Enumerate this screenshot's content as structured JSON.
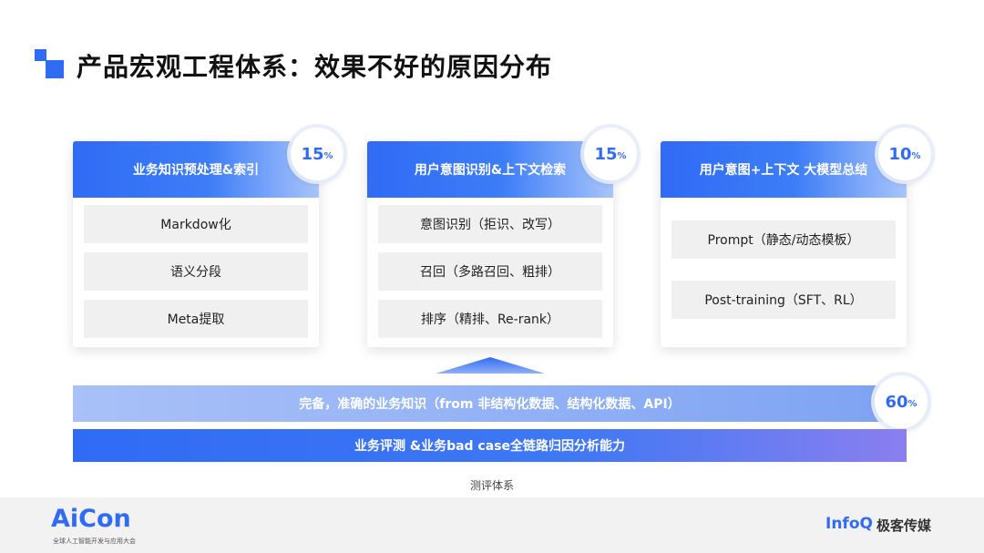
{
  "title": "产品宏观工程体系：效果不好的原因分布",
  "cards": [
    {
      "header": "业务知识预处理&索引",
      "percent": "15",
      "percent_unit": "%",
      "items": [
        "Markdow化",
        "语义分段",
        "Meta提取"
      ]
    },
    {
      "header": "用户意图识别&上下文检索",
      "percent": "15",
      "percent_unit": "%",
      "items": [
        "意图识别（拒识、改写）",
        "召回（多路召回、粗排）",
        "排序（精排、Re-rank）"
      ]
    },
    {
      "header": "用户意图+上下文 大模型总结",
      "percent": "10",
      "percent_unit": "%",
      "items": [
        "Prompt（静态/动态模板）",
        "Post-training（SFT、RL）"
      ]
    }
  ],
  "knowledge_bar": {
    "label": "完备，准确的业务知识（from 非结构化数据、结构化数据、API）",
    "percent": "60",
    "percent_unit": "%"
  },
  "eval_bar": {
    "label": "业务评测 &业务bad case全链路归因分析能力"
  },
  "eval_caption": "测评体系",
  "footer": {
    "aicon_logo": "AiCon",
    "aicon_sub": "全球人工智能开发与应用大会",
    "infoq_logo": "InfoQ",
    "geek_logo": "极客传媒"
  },
  "colors": {
    "accent": "#2f6bf5",
    "item_bg": "#f0f0f0",
    "footer_bg": "#f2f2f2"
  }
}
